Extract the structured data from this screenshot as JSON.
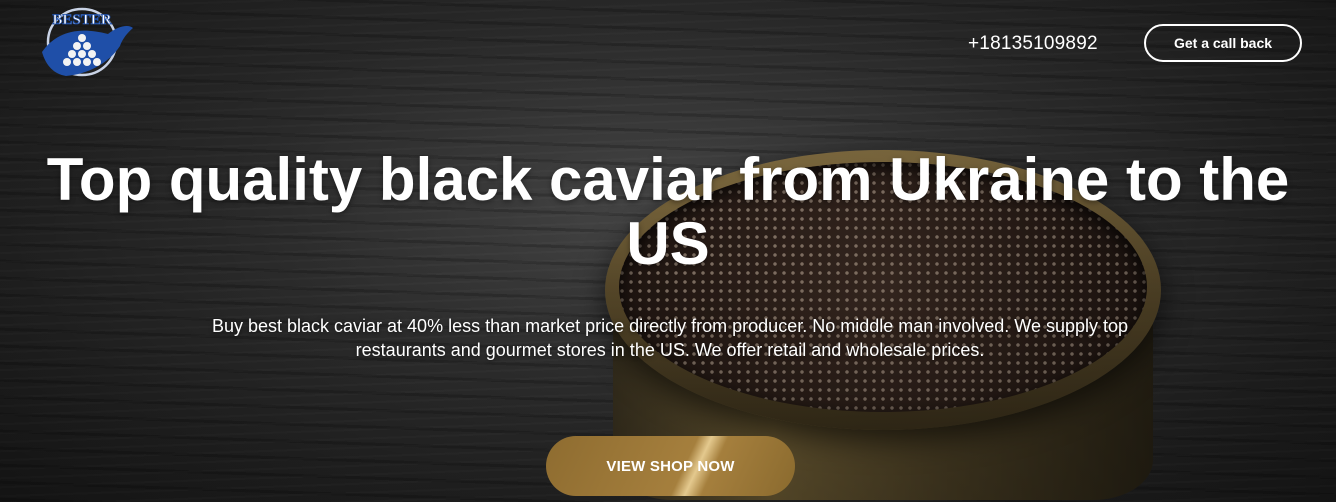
{
  "header": {
    "logo_text": "BESTER",
    "phone": "+18135109892",
    "callback_label": "Get a call back"
  },
  "hero": {
    "headline": "Top quality black caviar from Ukraine to the US",
    "description": "Buy best black caviar at 40% less than market price directly from producer. No middle man involved. We supply top restaurants and gourmet stores in the US. We offer retail and wholesale prices.",
    "cta_label": "VIEW SHOP NOW"
  },
  "colors": {
    "accent_gold": "#a57f3d",
    "logo_blue": "#1f4fa8",
    "text": "#ffffff"
  }
}
